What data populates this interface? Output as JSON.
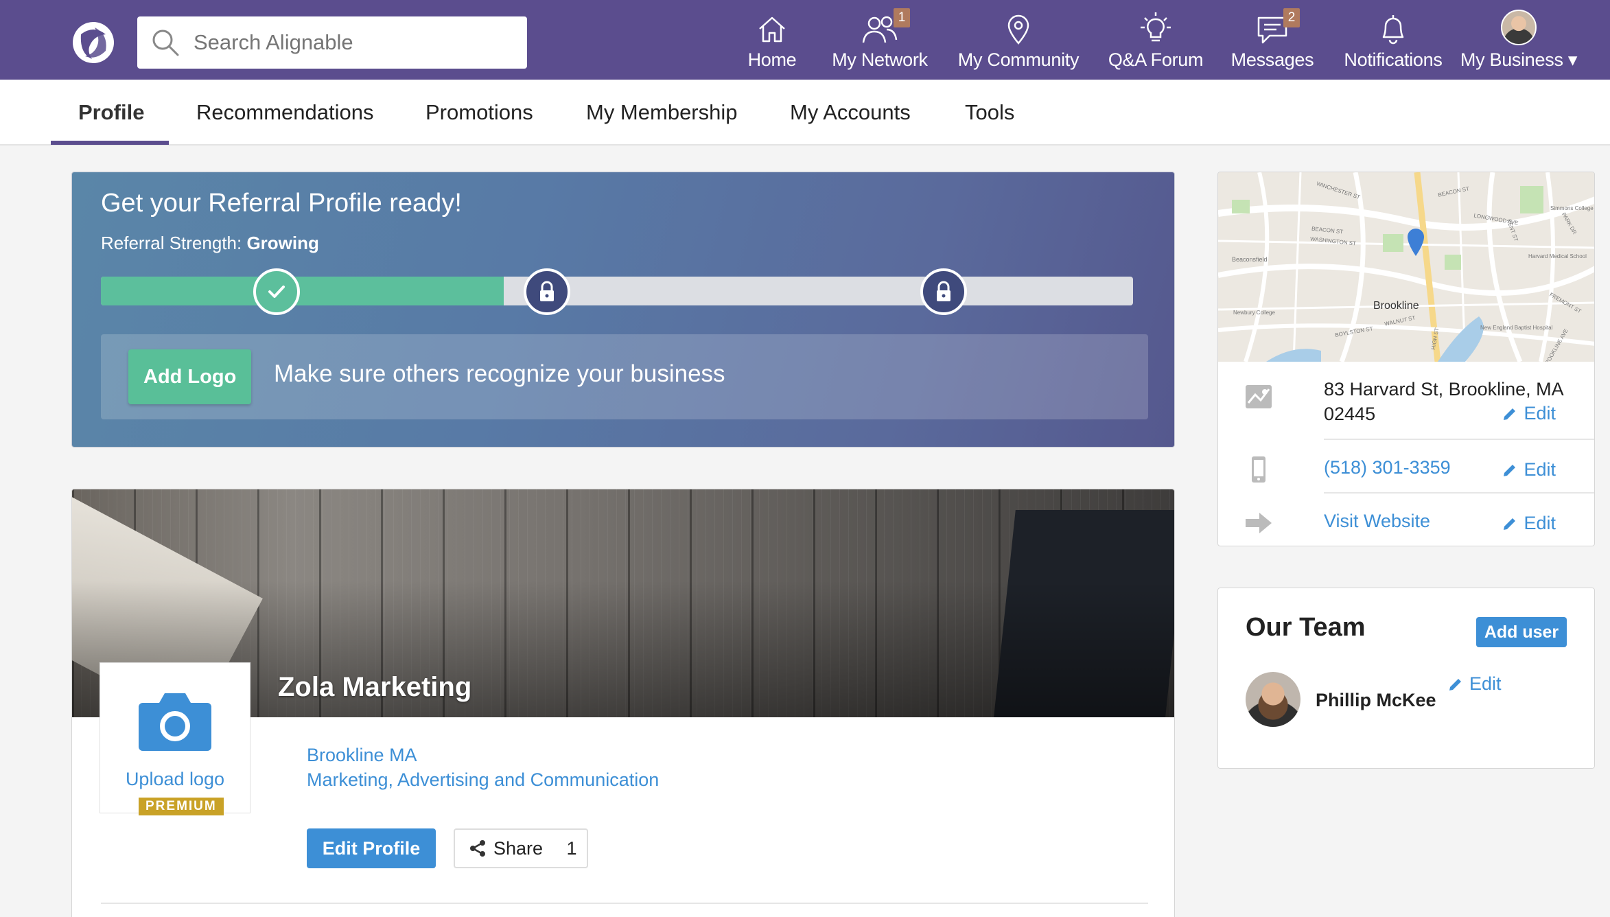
{
  "search": {
    "placeholder": "Search Alignable"
  },
  "nav": [
    {
      "label": "Home",
      "icon": "home-icon",
      "badge": ""
    },
    {
      "label": "My Network",
      "icon": "network-icon",
      "badge": "1"
    },
    {
      "label": "My Community",
      "icon": "location-pin-icon",
      "badge": ""
    },
    {
      "label": "Q&A Forum",
      "icon": "lightbulb-icon",
      "badge": ""
    },
    {
      "label": "Messages",
      "icon": "chat-icon",
      "badge": "2"
    },
    {
      "label": "Notifications",
      "icon": "bell-icon",
      "badge": ""
    },
    {
      "label": "My Business ▾",
      "icon": "avatar",
      "badge": ""
    }
  ],
  "tabs": [
    "Profile",
    "Recommendations",
    "Promotions",
    "My Membership",
    "My Accounts",
    "Tools"
  ],
  "referral": {
    "title": "Get your Referral Profile ready!",
    "strength_label": "Referral Strength:",
    "strength_value": "Growing",
    "progress_fraction": 0.39,
    "add_logo_label": "Add Logo",
    "message": "Make sure others recognize your business"
  },
  "business": {
    "name": "Zola Marketing",
    "upload_logo": "Upload logo",
    "premium": "PREMIUM",
    "location": "Brookline MA",
    "category": "Marketing, Advertising and Communication",
    "edit_profile": "Edit Profile",
    "share": "Share",
    "share_count": "1"
  },
  "contact": {
    "map_labels": [
      "Brookline",
      "WINCHESTER ST",
      "BEACON ST",
      "LONGWOOD AVE",
      "Simmons College",
      "Harvard Medical School",
      "BOYLSTON ST",
      "WALNUT ST",
      "Beaconsfield",
      "Newbury College",
      "BEACON ST",
      "WASHINGTON ST",
      "KENT ST",
      "HIGH ST",
      "FREMONT ST",
      "New England Baptist Hospital",
      "BROOKLINE AVE",
      "PARK DR"
    ],
    "address": "83 Harvard St, Brookline, MA 02445",
    "phone": "(518) 301-3359",
    "website": "Visit Website",
    "edit": "Edit"
  },
  "team": {
    "title": "Our Team",
    "add_user": "Add user",
    "member_name": "Phillip McKee",
    "edit": "Edit"
  },
  "colors": {
    "nav_bg": "#5b4d8e",
    "accent_blue": "#3d8fd6",
    "green": "#5cbf9c",
    "premium_gold": "#c9a227"
  }
}
